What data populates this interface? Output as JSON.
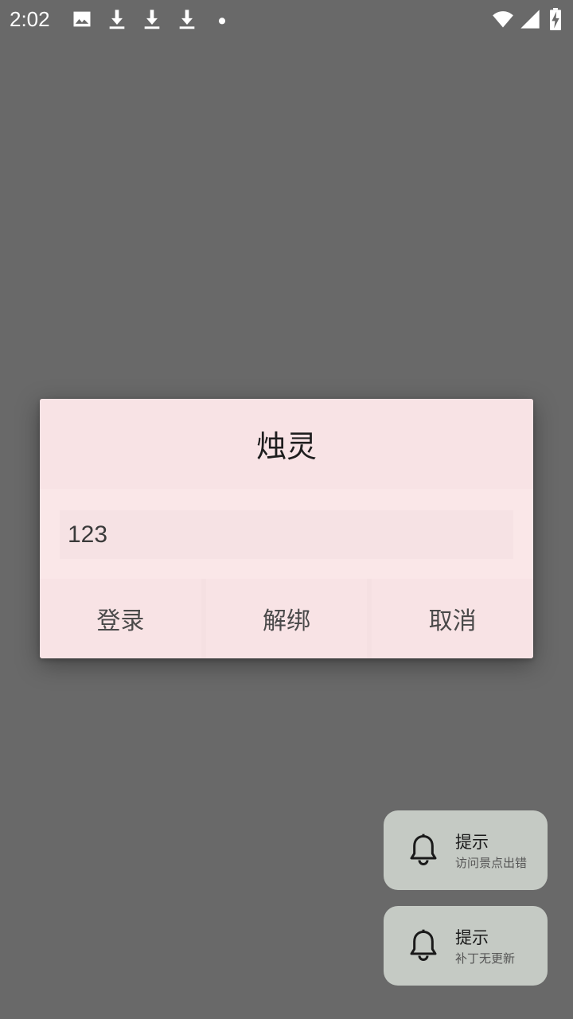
{
  "status_bar": {
    "time": "2:02",
    "left_icons": [
      "image-icon",
      "download-icon",
      "download-icon",
      "download-icon",
      "dot-icon"
    ],
    "right_icons": [
      "wifi-icon",
      "signal-icon",
      "battery-charging-icon"
    ]
  },
  "dialog": {
    "title": "烛灵",
    "input_value": "123",
    "buttons": {
      "login": "登录",
      "unbind": "解绑",
      "cancel": "取消"
    }
  },
  "toasts": [
    {
      "title": "提示",
      "text": "访问景点出错",
      "icon": "bell-icon"
    },
    {
      "title": "提示",
      "text": "补丁无更新",
      "icon": "bell-icon"
    }
  ],
  "colors": {
    "backdrop": "#696969",
    "dialog_background": "#f8e3e5",
    "toast_background": "#c5cac4"
  }
}
